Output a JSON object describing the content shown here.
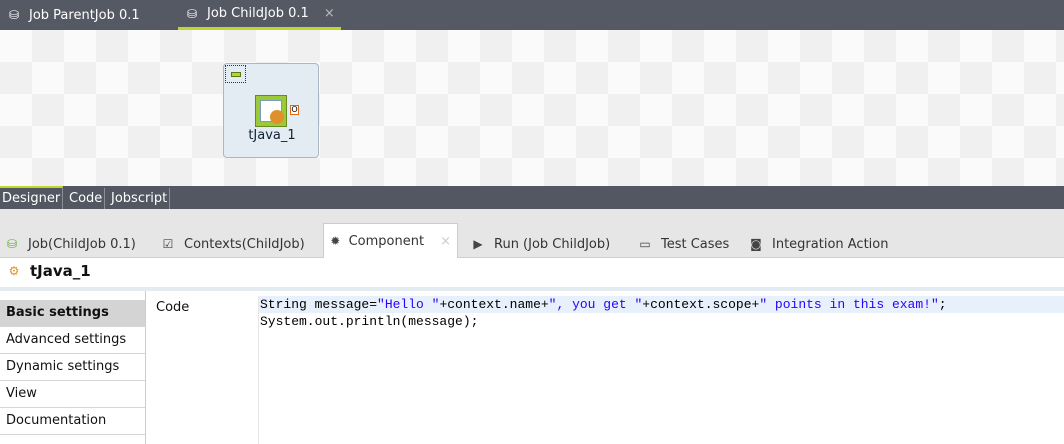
{
  "editor_tabs": [
    {
      "label": "Job ParentJob 0.1",
      "active": false
    },
    {
      "label": "Job ChildJob 0.1",
      "active": true
    }
  ],
  "close_glyph": "×",
  "canvas": {
    "component_label": "tJava_1",
    "port_label": "O"
  },
  "view_tabs": [
    "Designer",
    "Code",
    "Jobscript"
  ],
  "panel_tabs": [
    {
      "label": "Job(ChildJob 0.1)",
      "icon": "job-icon"
    },
    {
      "label": "Contexts(ChildJob)",
      "icon": "contexts-icon"
    },
    {
      "label": "Component",
      "icon": "palette-icon",
      "active": true
    },
    {
      "label": "Run (Job ChildJob)",
      "icon": "run-icon"
    },
    {
      "label": "Test Cases",
      "icon": "window-icon"
    },
    {
      "label": "Integration Action",
      "icon": "integration-icon"
    }
  ],
  "component_title": "tJava_1",
  "settings_nav": [
    "Basic settings",
    "Advanced settings",
    "Dynamic settings",
    "View",
    "Documentation"
  ],
  "field_label": "Code",
  "code": {
    "line1": [
      "String message=",
      "\"Hello \"",
      "+context.name+",
      "\", you get \"",
      "+context.scope+",
      "\" points in this exam!\"",
      ";"
    ],
    "line2": "System.out.println(message);"
  },
  "colors": {
    "accent": "#c0d62f",
    "dark_bar": "#555963",
    "string": "#2a00ff"
  }
}
